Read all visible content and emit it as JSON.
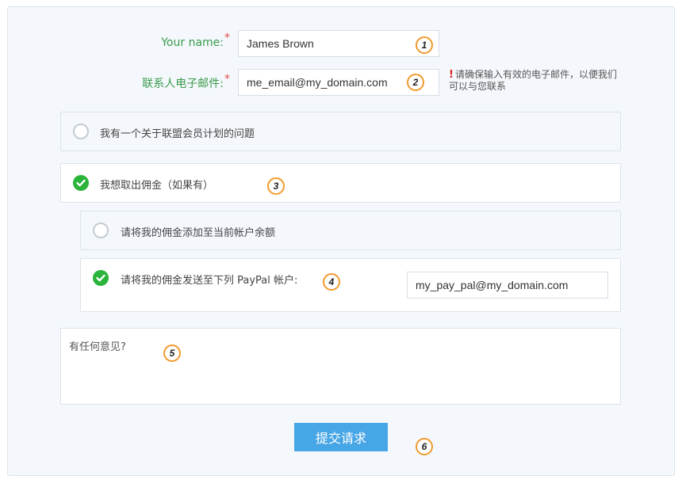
{
  "form": {
    "name": {
      "label": "Your name:",
      "required_mark": "*",
      "value": "James Brown",
      "badge": "1"
    },
    "email": {
      "label": "联系人电子邮件:",
      "required_mark": "*",
      "value": "me_email@my_domain.com",
      "badge": "2"
    },
    "email_warning": {
      "mark": "!",
      "text": "请确保输入有效的电子邮件，以便我们可以与您联系"
    },
    "options": [
      {
        "label": "我有一个关于联盟会员计划的问题",
        "checked": false
      },
      {
        "label": "我想取出佣金（如果有）",
        "checked": true,
        "badge": "3"
      }
    ],
    "sub_options": [
      {
        "label": "请将我的佣金添加至当前帐户余额",
        "checked": false
      },
      {
        "label": "请将我的佣金发送至下列 PayPal 帐户:",
        "checked": true,
        "badge": "4"
      }
    ],
    "paypal_input": {
      "value": "my_pay_pal@my_domain.com"
    },
    "comments": {
      "placeholder": "有任何意见?",
      "badge": "5"
    },
    "submit": {
      "label": "提交请求",
      "badge": "6"
    }
  },
  "colors": {
    "label_green": "#3a9a4a",
    "required_red": "#e24b4b",
    "check_green": "#2ab43a",
    "badge_orange": "#f29a2e",
    "submit_blue": "#47a6e6"
  }
}
